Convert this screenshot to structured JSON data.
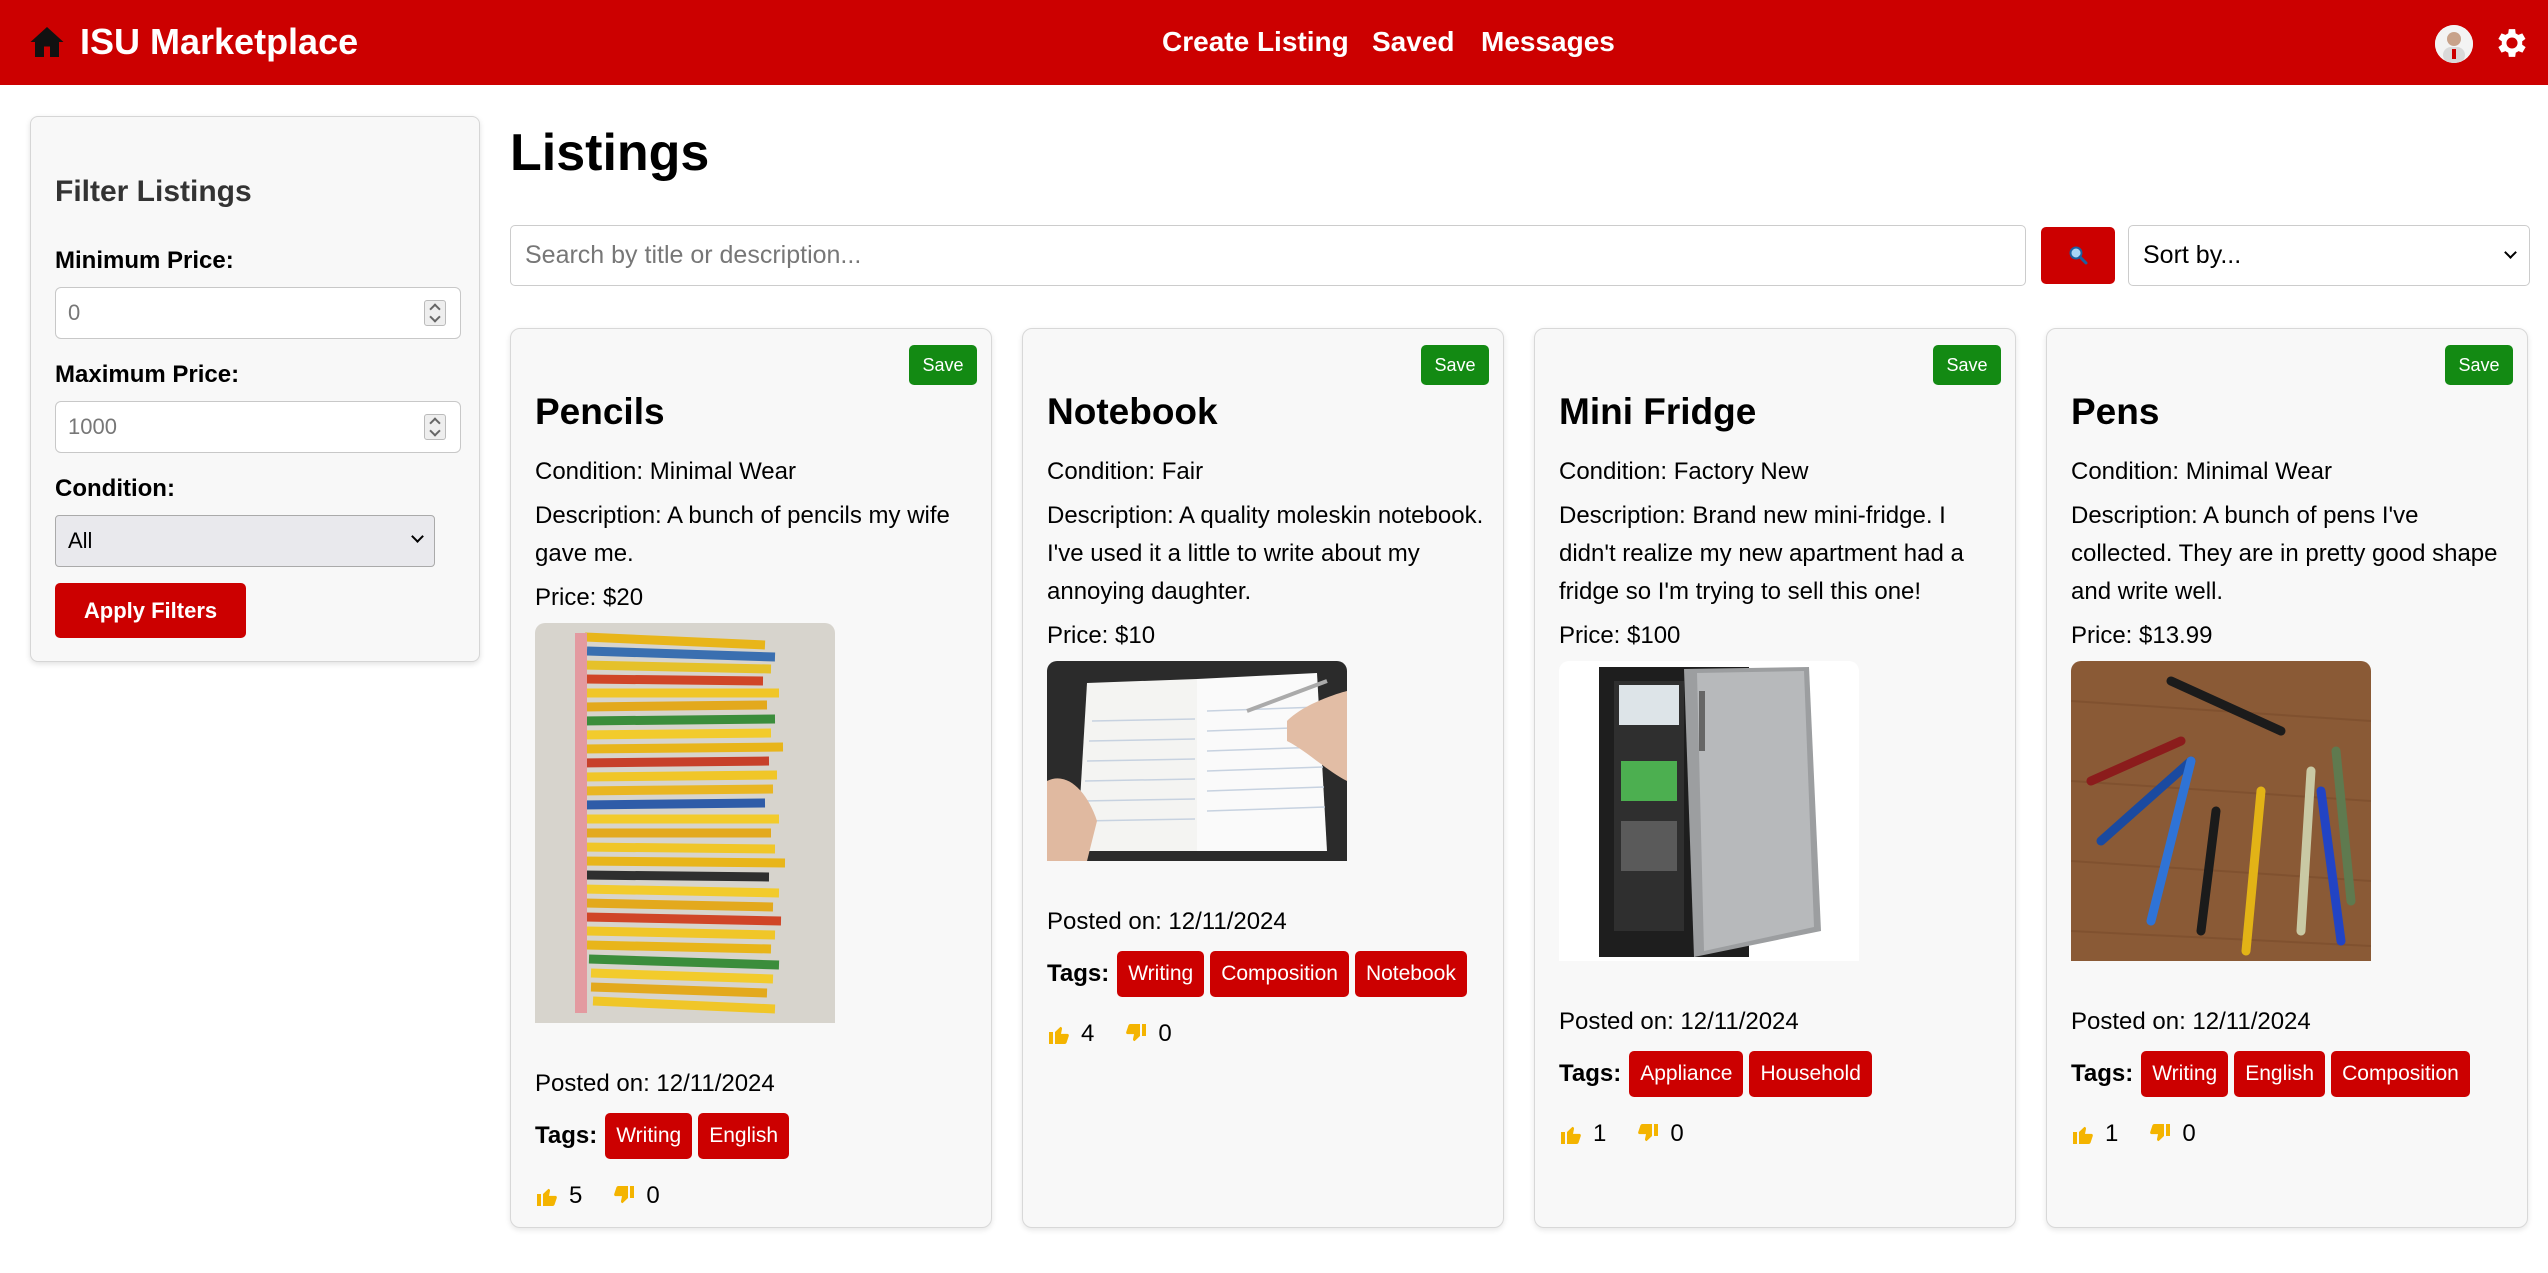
{
  "header": {
    "brand": "ISU Marketplace",
    "nav": {
      "create": "Create Listing",
      "saved": "Saved",
      "messages": "Messages"
    },
    "icons": [
      "home-icon",
      "avatar",
      "gear-icon"
    ],
    "accent": "#cc0000"
  },
  "filters": {
    "title": "Filter Listings",
    "min_label": "Minimum Price:",
    "min_placeholder": "0",
    "max_label": "Maximum Price:",
    "max_placeholder": "1000",
    "condition_label": "Condition:",
    "condition_value": "All",
    "apply_label": "Apply Filters"
  },
  "main": {
    "title": "Listings",
    "search_placeholder": "Search by title or description...",
    "sort_value": "Sort by..."
  },
  "listings": [
    {
      "save": "Save",
      "title": "Pencils",
      "condition": "Condition: Minimal Wear",
      "description": "Description: A bunch of pencils my wife gave me.",
      "price": "Price: $20",
      "posted": "Posted on: 12/11/2024",
      "tags_label": "Tags:",
      "tags": [
        "Writing",
        "English"
      ],
      "likes": "5",
      "dislikes": "0"
    },
    {
      "save": "Save",
      "title": "Notebook",
      "condition": "Condition: Fair",
      "description": "Description: A quality moleskin notebook. I've used it a little to write about my annoying daughter.",
      "price": "Price: $10",
      "posted": "Posted on: 12/11/2024",
      "tags_label": "Tags:",
      "tags": [
        "Writing",
        "Composition",
        "Notebook"
      ],
      "likes": "4",
      "dislikes": "0"
    },
    {
      "save": "Save",
      "title": "Mini Fridge",
      "condition": "Condition: Factory New",
      "description": "Description: Brand new mini-fridge. I didn't realize my new apartment had a fridge so I'm trying to sell this one!",
      "price": "Price: $100",
      "posted": "Posted on: 12/11/2024",
      "tags_label": "Tags:",
      "tags": [
        "Appliance",
        "Household"
      ],
      "likes": "1",
      "dislikes": "0"
    },
    {
      "save": "Save",
      "title": "Pens",
      "condition": "Condition: Minimal Wear",
      "description": "Description: A bunch of pens I've collected. They are in pretty good shape and write well.",
      "price": "Price: $13.99",
      "posted": "Posted on: 12/11/2024",
      "tags_label": "Tags:",
      "tags": [
        "Writing",
        "English",
        "Composition"
      ],
      "likes": "1",
      "dislikes": "0"
    }
  ]
}
